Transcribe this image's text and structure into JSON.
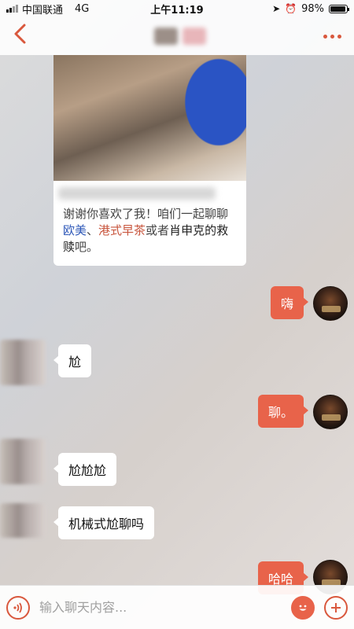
{
  "status_bar": {
    "carrier": "中国联通",
    "network": "4G",
    "time": "上午11:19",
    "battery": "98%"
  },
  "nav": {
    "back_icon": "chevron-left-icon",
    "more_icon": "more-dots-icon",
    "accent_color": "#d9583d"
  },
  "card": {
    "text_1": "谢谢你喜欢了我！咱们一起聊聊",
    "tag_1": "欧美",
    "sep": "、",
    "tag_2": "港式早茶",
    "text_2": "或者",
    "tag_3": "肖申克的救赎",
    "text_3": "吧。"
  },
  "messages": [
    {
      "side": "out",
      "text": "嗨"
    },
    {
      "side": "in",
      "text": "尬"
    },
    {
      "side": "out",
      "text": "聊。"
    },
    {
      "side": "in",
      "text": "尬尬尬"
    },
    {
      "side": "in",
      "text": "机械式尬聊吗"
    },
    {
      "side": "out",
      "text": "哈哈"
    }
  ],
  "input_bar": {
    "placeholder": "输入聊天内容...",
    "voice_icon": "voice-icon",
    "emoji_icon": "emoji-icon",
    "plus_icon": "plus-icon",
    "outgoing_bubble_color": "#e8634a"
  }
}
